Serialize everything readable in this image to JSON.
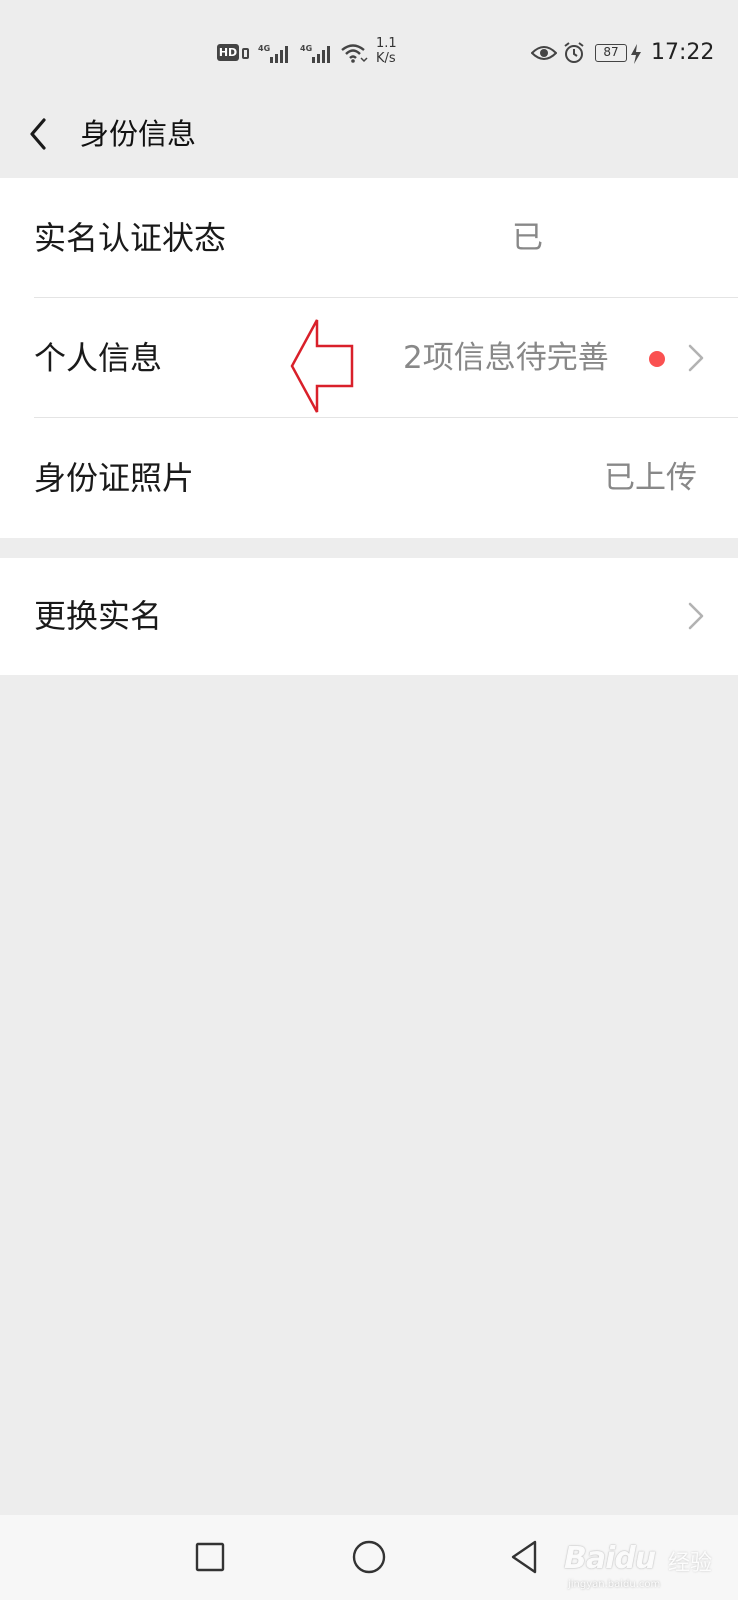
{
  "status_bar": {
    "hd_label": "HD",
    "network_1": "4G",
    "network_2": "4G",
    "speed_value": "1.1",
    "speed_unit": "K/s",
    "battery": "87",
    "time": "17:22",
    "icons": [
      "hd-icon",
      "signal-icon",
      "wifi-icon",
      "eye-icon",
      "alarm-icon",
      "battery-icon",
      "charging-icon"
    ]
  },
  "header": {
    "title": "身份信息"
  },
  "rows": [
    {
      "label": "实名认证状态",
      "value": "已"
    },
    {
      "label": "个人信息",
      "value": "2项信息待完善"
    },
    {
      "label": "身份证照片",
      "value": "已上传"
    }
  ],
  "group2": {
    "label": "更换实名"
  },
  "watermark": {
    "brand": "Baidu",
    "brand_cn": "经验",
    "url": "jingyan.baidu.com"
  },
  "colors": {
    "background": "#ededed",
    "card": "#ffffff",
    "value_text": "#888888",
    "red_dot": "#fa5151",
    "annotation_arrow": "#d9202a"
  }
}
